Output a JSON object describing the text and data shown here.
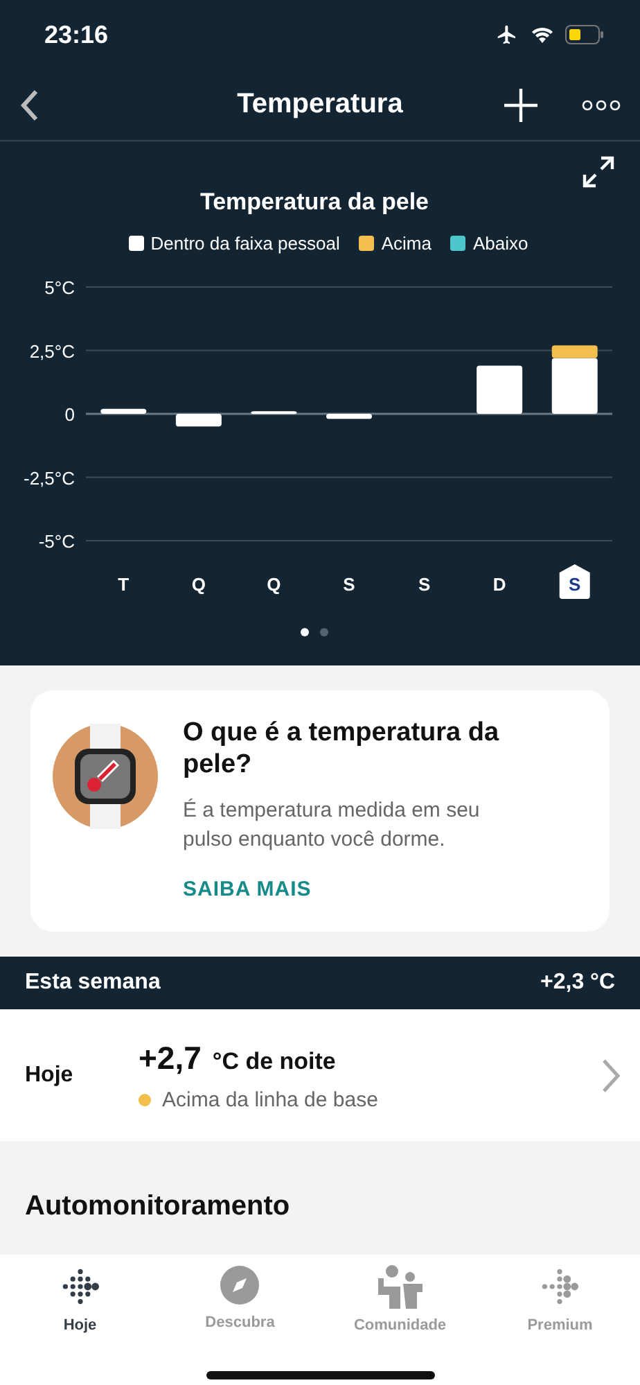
{
  "status_bar": {
    "time": "23:16"
  },
  "nav": {
    "title": "Temperatura"
  },
  "chart": {
    "last_day_highlighted": true,
    "page_dots": [
      {
        "selected": true
      },
      {
        "selected": false
      }
    ],
    "chart_data": {
      "type": "bar",
      "title": "Temperatura da pele",
      "stacked": true,
      "categories": [
        "T",
        "Q",
        "Q",
        "S",
        "S",
        "D",
        "S"
      ],
      "ylim": [
        -5,
        5
      ],
      "yticks": [
        {
          "value": 5,
          "label": "5°C"
        },
        {
          "value": 2.5,
          "label": "2,5°C"
        },
        {
          "value": 0,
          "label": "0"
        },
        {
          "value": -2.5,
          "label": "-2,5°C"
        },
        {
          "value": -5,
          "label": "-5°C"
        }
      ],
      "series": [
        {
          "name": "Dentro da faixa pessoal",
          "color": "#ffffff",
          "values": [
            0.2,
            -0.5,
            0.1,
            -0.2,
            0,
            1.9,
            2.2
          ]
        },
        {
          "name": "Acima",
          "color": "#f2bf4c",
          "values": [
            0,
            0,
            0,
            0,
            0,
            0,
            0.5
          ]
        },
        {
          "name": "Abaixo",
          "color": "#4cc6cb",
          "values": [
            0,
            0,
            0,
            0,
            0,
            0,
            0
          ]
        }
      ]
    }
  },
  "info_card": {
    "title": "O que é a temperatura da pele?",
    "body": "É a temperatura medida em seu pulso enquanto você dorme.",
    "link": "SAIBA MAIS"
  },
  "week_bar": {
    "label": "Esta semana",
    "value": "+2,3 °C"
  },
  "today": {
    "label": "Hoje",
    "value": "+2,7",
    "unit": "°C de noite",
    "status": "Acima da linha de base",
    "color": "#f2bf4c"
  },
  "section": {
    "title": "Automonitoramento"
  },
  "tabs": [
    {
      "label": "Hoje",
      "selected": true
    },
    {
      "label": "Descubra",
      "selected": false
    },
    {
      "label": "Comunidade",
      "selected": false
    },
    {
      "label": "Premium",
      "selected": false
    }
  ]
}
